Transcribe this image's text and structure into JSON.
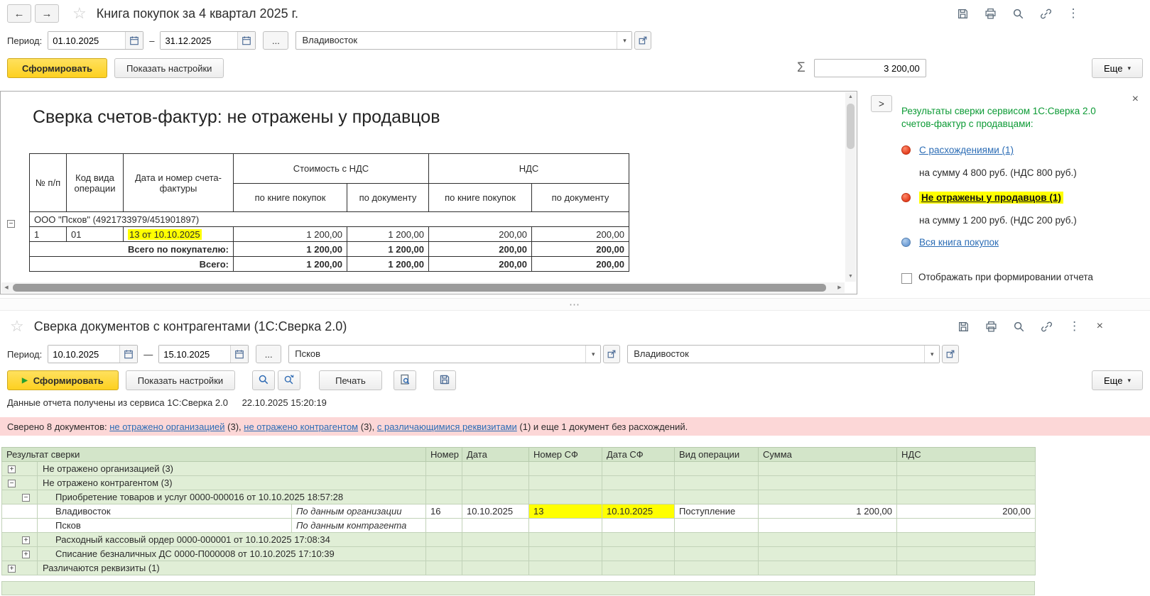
{
  "glyphs": {
    "back_arrow": "←",
    "forward_arrow": "→",
    "star": "☆",
    "kebab": "⋮",
    "close": "×",
    "dropdown": "▾",
    "sigma": "Σ",
    "collapse_right": ">",
    "scroll_up": "▲",
    "scroll_down": "▼",
    "scroll_left": "◀",
    "scroll_right": "▶",
    "expand_plus": "+",
    "collapse_minus": "−",
    "splitter_dots": "⋯",
    "play": "▶"
  },
  "colors": {
    "accent_yellow_button": "#fdd020",
    "highlight_yellow": "#ffff00",
    "link_blue": "#2b6cb5",
    "panel_green_text": "#0b9a34",
    "banner_pink": "#fcd7d7",
    "table_green": "#e0eed6",
    "marker_red": "#e23c1e",
    "marker_blue": "#6c9cd5"
  },
  "top_window": {
    "title": "Книга покупок за 4 квартал 2025 г.",
    "filters": {
      "period_label": "Период:",
      "period_from": "01.10.2025",
      "period_separator": "–",
      "period_to": "31.12.2025",
      "more_periods_button": "...",
      "organization": "Владивосток"
    },
    "actions": {
      "generate": "Сформировать",
      "show_settings": "Показать настройки",
      "sum_value": "3 200,00",
      "more": "Еще"
    },
    "report": {
      "heading": "Сверка счетов-фактур: не отражены у продавцов",
      "columns": {
        "npp": "№ п/п",
        "op_code": "Код вида операции",
        "invoice": "Дата и номер счета-фактуры",
        "cost_group": "Стоимость с НДС",
        "vat_group": "НДС",
        "by_book": "по книге покупок",
        "by_doc": "по документу"
      },
      "group_header": "ООО \"Псков\" (4921733979/451901897)",
      "data_row": {
        "npp": "1",
        "op_code": "01",
        "invoice": "13 от 10.10.2025",
        "cost_by_book": "1 200,00",
        "cost_by_doc": "1 200,00",
        "vat_by_book": "200,00",
        "vat_by_doc": "200,00"
      },
      "total_buyer": {
        "label": "Всего по покупателю:",
        "cost_by_book": "1 200,00",
        "cost_by_doc": "1 200,00",
        "vat_by_book": "200,00",
        "vat_by_doc": "200,00"
      },
      "total": {
        "label": "Всего:",
        "cost_by_book": "1 200,00",
        "cost_by_doc": "1 200,00",
        "vat_by_book": "200,00",
        "vat_by_doc": "200,00"
      }
    },
    "side_panel": {
      "header": "Результаты сверки сервисом 1С:Сверка 2.0 счетов-фактур с продавцами:",
      "with_diff_link": "С расхождениями (1)",
      "with_diff_sum": "на сумму 4 800 руб. (НДС 800 руб.)",
      "not_reflected_link": "Не отражены у продавцов (1)",
      "not_reflected_sum": "на сумму 1 200 руб. (НДС 200 руб.)",
      "whole_book_link": "Вся книга покупок",
      "checkbox_label": "Отображать при формировании отчета"
    }
  },
  "bottom_window": {
    "title": "Сверка документов с контрагентами (1С:Сверка 2.0)",
    "filters": {
      "period_label": "Период:",
      "period_from": "10.10.2025",
      "period_separator": "—",
      "period_to": "15.10.2025",
      "more_periods_button": "...",
      "organization": "Псков",
      "counterparty": "Владивосток"
    },
    "actions": {
      "generate": "Сформировать",
      "show_settings": "Показать настройки",
      "print": "Печать",
      "more": "Еще"
    },
    "status_line": "Данные отчета получены из сервиса 1С:Сверка 2.0",
    "status_time": "22.10.2025 15:20:19",
    "banner": {
      "prefix": "Сверено 8 документов: ",
      "org_link": "не отражено организацией",
      "after_org": " (3), ",
      "cp_link": "не отражено контрагентом",
      "after_cp": " (3), ",
      "req_link": "с различающимися реквизитами",
      "suffix": " (1) и еще 1 документ без расхождений."
    },
    "table": {
      "headers": [
        "Результат сверки",
        "Номер",
        "Дата",
        "Номер СФ",
        "Дата СФ",
        "Вид операции",
        "Сумма",
        "НДС"
      ],
      "rows": [
        {
          "label": "Не отражено организацией (3)"
        },
        {
          "label": "Не отражено контрагентом (3)"
        },
        {
          "label": "Приобретение товаров и услуг 0000-000016 от 10.10.2025 18:57:28"
        },
        {
          "name": "Владивосток",
          "source": "По данным организации",
          "number": "16",
          "date": "10.10.2025",
          "number_sf": "13",
          "date_sf": "10.10.2025",
          "operation": "Поступление",
          "amount": "1 200,00",
          "vat": "200,00"
        },
        {
          "name": "Псков",
          "source": "По данным контрагента",
          "number": "",
          "date": "",
          "number_sf": "",
          "date_sf": "",
          "operation": "",
          "amount": "",
          "vat": ""
        },
        {
          "label": "Расходный кассовый ордер 0000-000001 от 10.10.2025 17:08:34"
        },
        {
          "label": "Списание безналичных ДС 0000-П000008 от 10.10.2025 17:10:39"
        },
        {
          "label": "Различаются реквизиты (1)"
        }
      ]
    }
  }
}
